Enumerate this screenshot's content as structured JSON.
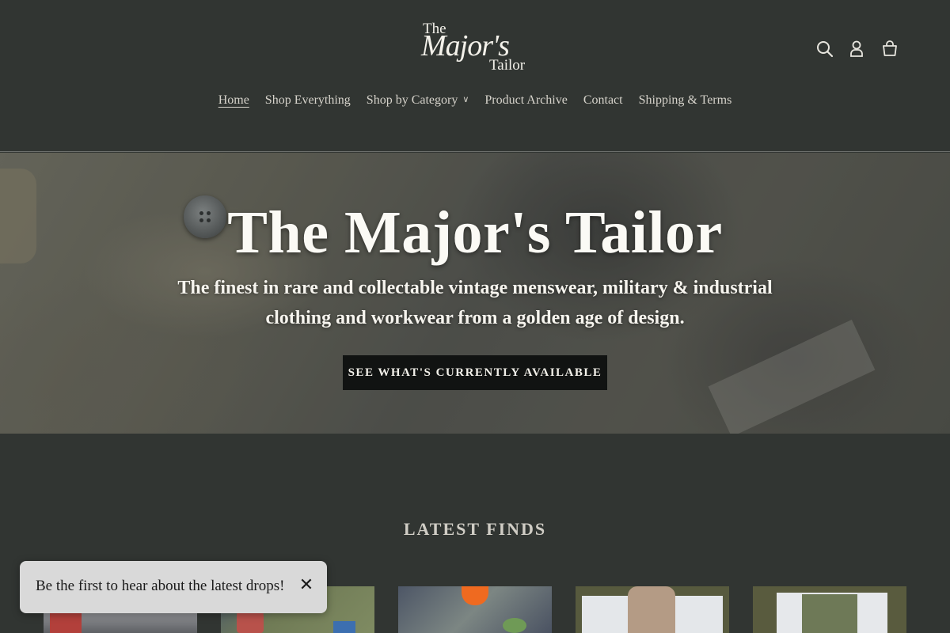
{
  "brand": {
    "line1": "The",
    "line2": "Major's",
    "line3": "Tailor"
  },
  "header": {
    "icons": [
      "search-icon",
      "account-icon",
      "cart-icon"
    ]
  },
  "nav": {
    "items": [
      {
        "label": "Home",
        "active": true
      },
      {
        "label": "Shop Everything",
        "active": false
      },
      {
        "label": "Shop by Category",
        "active": false,
        "dropdown": true
      },
      {
        "label": "Product Archive",
        "active": false
      },
      {
        "label": "Contact",
        "active": false
      },
      {
        "label": "Shipping & Terms",
        "active": false
      }
    ]
  },
  "hero": {
    "title": "The Major's Tailor",
    "subtitle": "The finest in rare and collectable vintage menswear, military & industrial clothing and workwear from a golden age of design.",
    "cta": "SEE WHAT'S CURRENTLY AVAILABLE"
  },
  "latest": {
    "title": "LATEST FINDS"
  },
  "popup": {
    "text": "Be the first to hear about the latest drops!",
    "close": "✕"
  },
  "colors": {
    "background": "#313532",
    "cta_background": "#111312",
    "popup_background": "#d9d9d9"
  }
}
